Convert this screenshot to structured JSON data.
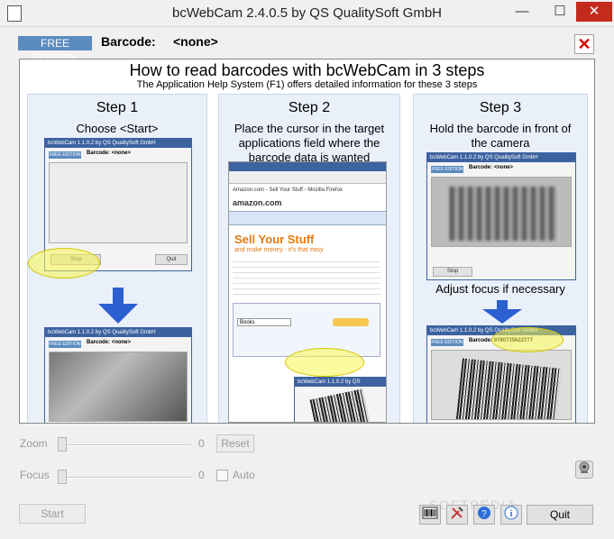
{
  "window": {
    "title": "bcWebCam 2.4.0.5 by QS QualitySoft GmbH",
    "minimize_glyph": "—",
    "maximize_glyph": "☐",
    "close_glyph": "✕"
  },
  "header": {
    "edition": "FREE EDITION",
    "barcode_label": "Barcode:",
    "barcode_value": "<none>",
    "close_glyph": "✕"
  },
  "help": {
    "title": "How to read barcodes with bcWebCam in 3 steps",
    "subtitle": "The Application Help System (F1) offers detailed information for these 3 steps",
    "steps": [
      {
        "heading": "Step 1",
        "text": "Choose <Start>"
      },
      {
        "heading": "Step 2",
        "text": "Place the cursor in the target applications field where the barcode data is wanted"
      },
      {
        "heading": "Step 3",
        "text": "Hold the barcode in front of the camera",
        "text2": "Adjust focus if necessary"
      }
    ],
    "mini": {
      "title": "bcWebCam 1.1.0.2 by QS QualitySoft GmbH",
      "edition": "FREE EDITION",
      "barcode": "Barcode:",
      "none": "<none>",
      "value": "9780735622777",
      "stop": "Stop",
      "quit": "Quit"
    },
    "browser": {
      "title": "Amazon.com - Sell Your Stuff - Mozilla Firefox",
      "brand": "amazon.com",
      "heading": "Sell Your Stuff",
      "tagline": "and make money - it's that easy",
      "field": "Books"
    }
  },
  "controls": {
    "zoom_label": "Zoom",
    "zoom_value": "0",
    "reset_label": "Reset",
    "focus_label": "Focus",
    "focus_value": "0",
    "auto_label": "Auto",
    "start_label": "Start",
    "quit_label": "Quit"
  },
  "watermark": "SOFTPEDIA"
}
